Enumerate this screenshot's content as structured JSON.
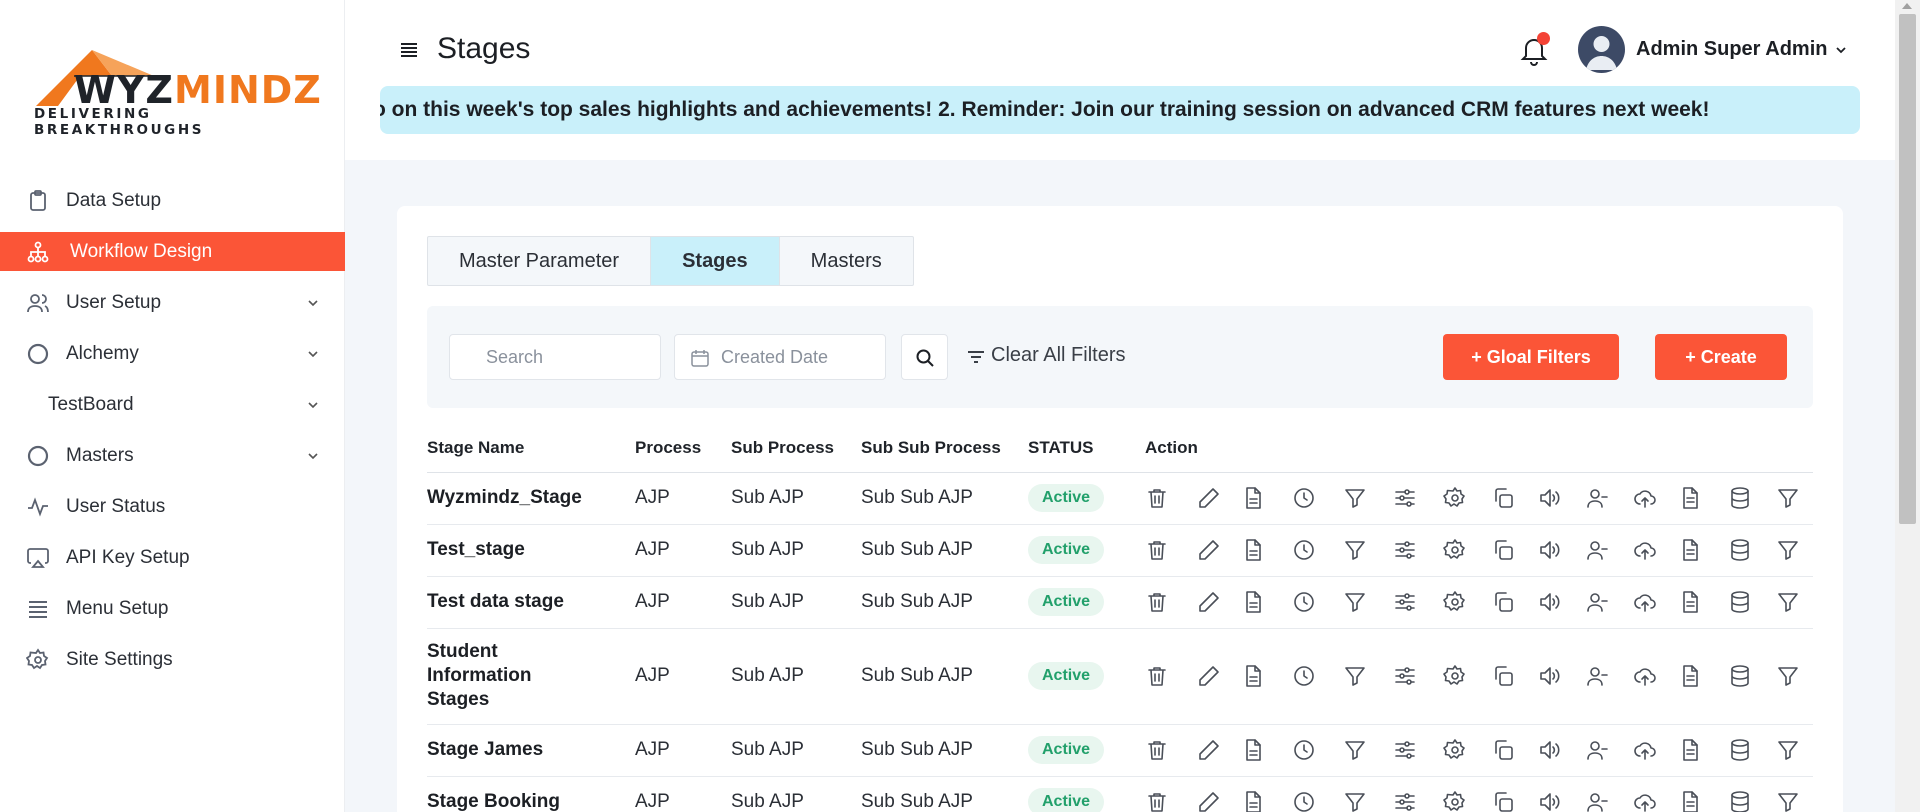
{
  "brand": {
    "name_prefix": "WYZ",
    "name_accent": "MINDZ",
    "tagline": "DELIVERING BREAKTHROUGHS",
    "accent_color": "#f0781e"
  },
  "sidebar": {
    "items": [
      {
        "label": "Data Setup",
        "icon": "clipboard-icon",
        "has_chevron": false
      },
      {
        "label": "Workflow Design",
        "icon": "workflow-icon",
        "active": true,
        "has_chevron": false
      },
      {
        "label": "User Setup",
        "icon": "users-icon",
        "has_chevron": true
      },
      {
        "label": "Alchemy",
        "icon": "circle-icon",
        "has_chevron": true
      },
      {
        "label": "TestBoard",
        "icon": "",
        "has_chevron": true
      },
      {
        "label": "Masters",
        "icon": "circle-icon",
        "has_chevron": true
      },
      {
        "label": "User Status",
        "icon": "activity-icon",
        "has_chevron": false
      },
      {
        "label": "API Key Setup",
        "icon": "airplay-icon",
        "has_chevron": false
      },
      {
        "label": "Menu Setup",
        "icon": "list-icon",
        "has_chevron": false
      },
      {
        "label": "Site Settings",
        "icon": "gear-icon",
        "has_chevron": false
      }
    ]
  },
  "header": {
    "title": "Stages",
    "user_name": "Admin Super Admin",
    "announcement": "o on this week's top sales highlights and achievements! 2. Reminder: Join our training session on advanced CRM features next week!"
  },
  "tabs": [
    {
      "label": "Master Parameter",
      "active": false
    },
    {
      "label": "Stages",
      "active": true
    },
    {
      "label": "Masters",
      "active": false
    }
  ],
  "filters": {
    "search_placeholder": "Search",
    "date_placeholder": "Created Date",
    "clear_label": "Clear All Filters",
    "global_filters_label": "+ Gloal Filters",
    "create_label": "+ Create"
  },
  "table": {
    "columns": [
      "Stage Name",
      "Process",
      "Sub Process",
      "Sub Sub Process",
      "STATUS",
      "Action"
    ],
    "rows": [
      {
        "name": "Wyzmindz_Stage",
        "process": "AJP",
        "sub": "Sub AJP",
        "subsub": "Sub Sub AJP",
        "status": "Active"
      },
      {
        "name": "Test_stage",
        "process": "AJP",
        "sub": "Sub AJP",
        "subsub": "Sub Sub AJP",
        "status": "Active"
      },
      {
        "name": "Test data stage",
        "process": "AJP",
        "sub": "Sub AJP",
        "subsub": "Sub Sub AJP",
        "status": "Active"
      },
      {
        "name": "Student Information Stages",
        "process": "AJP",
        "sub": "Sub AJP",
        "subsub": "Sub Sub AJP",
        "status": "Active"
      },
      {
        "name": "Stage James",
        "process": "AJP",
        "sub": "Sub AJP",
        "subsub": "Sub Sub AJP",
        "status": "Active"
      },
      {
        "name": "Stage Booking",
        "process": "AJP",
        "sub": "Sub AJP",
        "subsub": "Sub Sub AJP",
        "status": "Active"
      }
    ],
    "action_icons": [
      "trash-icon",
      "edit-icon",
      "document-icon",
      "clock-icon",
      "filter-icon",
      "sliders-icon",
      "gear-icon",
      "copy-icon",
      "speaker-icon",
      "user-minus-icon",
      "upload-cloud-icon",
      "file-text-icon",
      "database-icon",
      "funnel-icon"
    ]
  },
  "colors": {
    "primary": "#fb5537",
    "active_tab": "#c9f0fa",
    "status_active": "#22a06b"
  }
}
